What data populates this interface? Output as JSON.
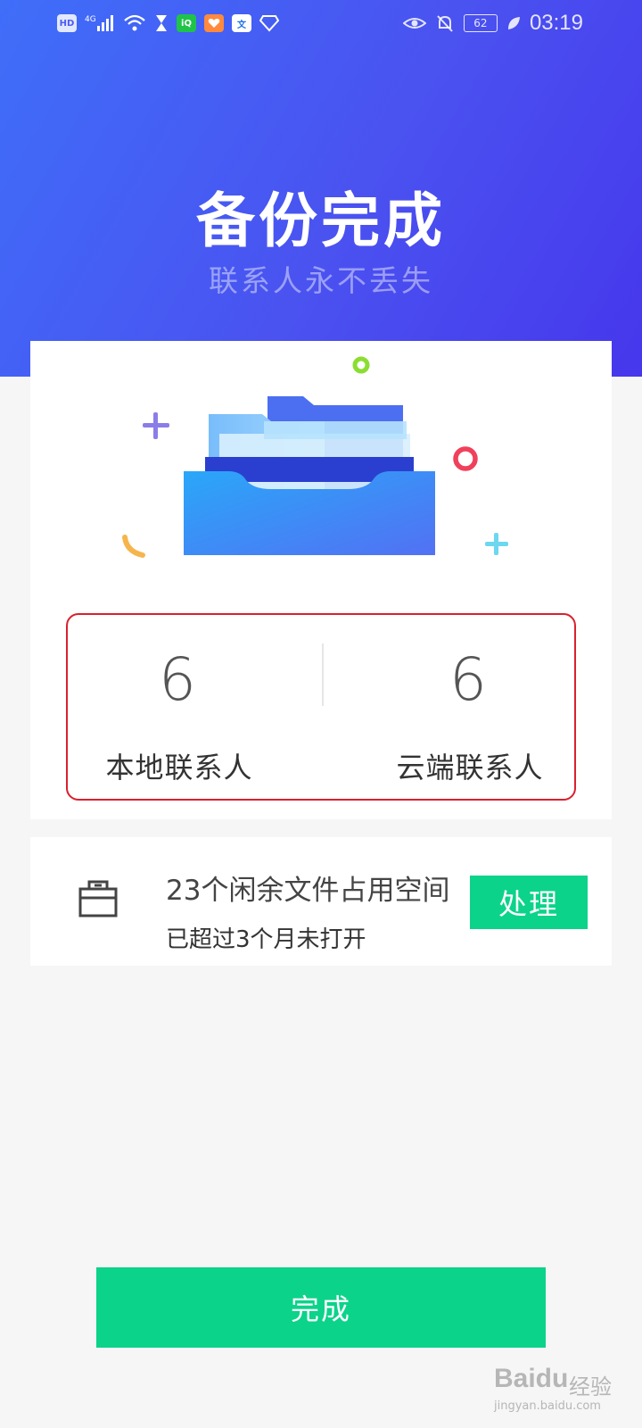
{
  "status_bar": {
    "hd": "HD",
    "network": "4G",
    "battery": "62",
    "time": "03:19"
  },
  "header": {
    "title": "备份完成",
    "subtitle": "联系人永不丢失"
  },
  "stats": {
    "local": {
      "count": "6",
      "label": "本地联系人"
    },
    "cloud": {
      "count": "6",
      "label": "云端联系人"
    }
  },
  "idle_files": {
    "title": "23个闲余文件占用空间",
    "subtitle": "已超过3个月未打开",
    "action_label": "处理"
  },
  "footer": {
    "done_label": "完成"
  },
  "watermark": {
    "main": "Baidu",
    "cn": "经验",
    "url": "jingyan.baidu.com"
  },
  "colors": {
    "accent_green": "#0bd38a",
    "header_gradient_start": "#3f6ef9",
    "header_gradient_end": "#4637ec",
    "highlight_border": "#d9202e"
  }
}
